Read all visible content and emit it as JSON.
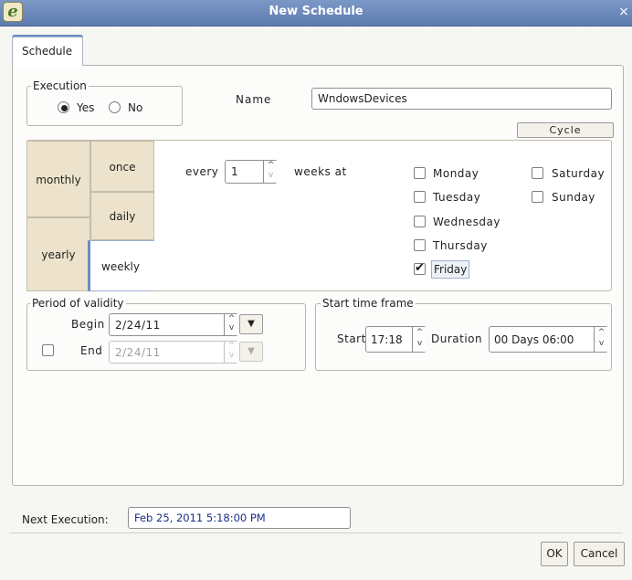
{
  "window": {
    "title": "New Schedule",
    "close_glyph": "×",
    "logo_glyph": "e"
  },
  "tabs": [
    {
      "label": "Schedule",
      "active": true
    }
  ],
  "execution": {
    "legend": "Execution",
    "yes_label": "Yes",
    "no_label": "No",
    "selected": "Yes"
  },
  "name": {
    "label": "Name",
    "value": "WndowsDevices"
  },
  "cycle": {
    "label": "Cycle"
  },
  "frequency": {
    "outer_tabs": [
      {
        "label": "monthly"
      },
      {
        "label": "yearly"
      }
    ],
    "inner_tabs": [
      {
        "label": "once"
      },
      {
        "label": "daily"
      },
      {
        "label": "weekly",
        "active": true
      }
    ],
    "every_label": "every",
    "every_value": "1",
    "weeks_at_label": "weeks at"
  },
  "weekdays": [
    {
      "label": "Monday",
      "checked": false
    },
    {
      "label": "Tuesday",
      "checked": false
    },
    {
      "label": "Wednesday",
      "checked": false
    },
    {
      "label": "Thursday",
      "checked": false
    },
    {
      "label": "Friday",
      "checked": true
    },
    {
      "label": "Saturday",
      "checked": false
    },
    {
      "label": "Sunday",
      "checked": false
    }
  ],
  "validity": {
    "legend": "Period of validity",
    "begin_label": "Begin",
    "begin_value": "2/24/11",
    "end_label": "End",
    "end_value": "2/24/11",
    "end_enabled": false
  },
  "time_frame": {
    "legend": "Start time frame",
    "start_label": "Start",
    "start_value": "17:18",
    "duration_label": "Duration",
    "duration_value": "00 Days 06:00"
  },
  "next_execution": {
    "label": "Next Execution:",
    "value": "Feb 25, 2011 5:18:00 PM"
  },
  "buttons": {
    "ok": "OK",
    "cancel": "Cancel"
  },
  "icons": {
    "check_glyph": "✔",
    "up_glyph": "^",
    "down_glyph": "v",
    "dropdown_glyph": "▼"
  },
  "colors": {
    "title_bar": "#6a87bd",
    "tab_panel": "#ede3cc",
    "next_exec_text": "#1a2f8a"
  }
}
